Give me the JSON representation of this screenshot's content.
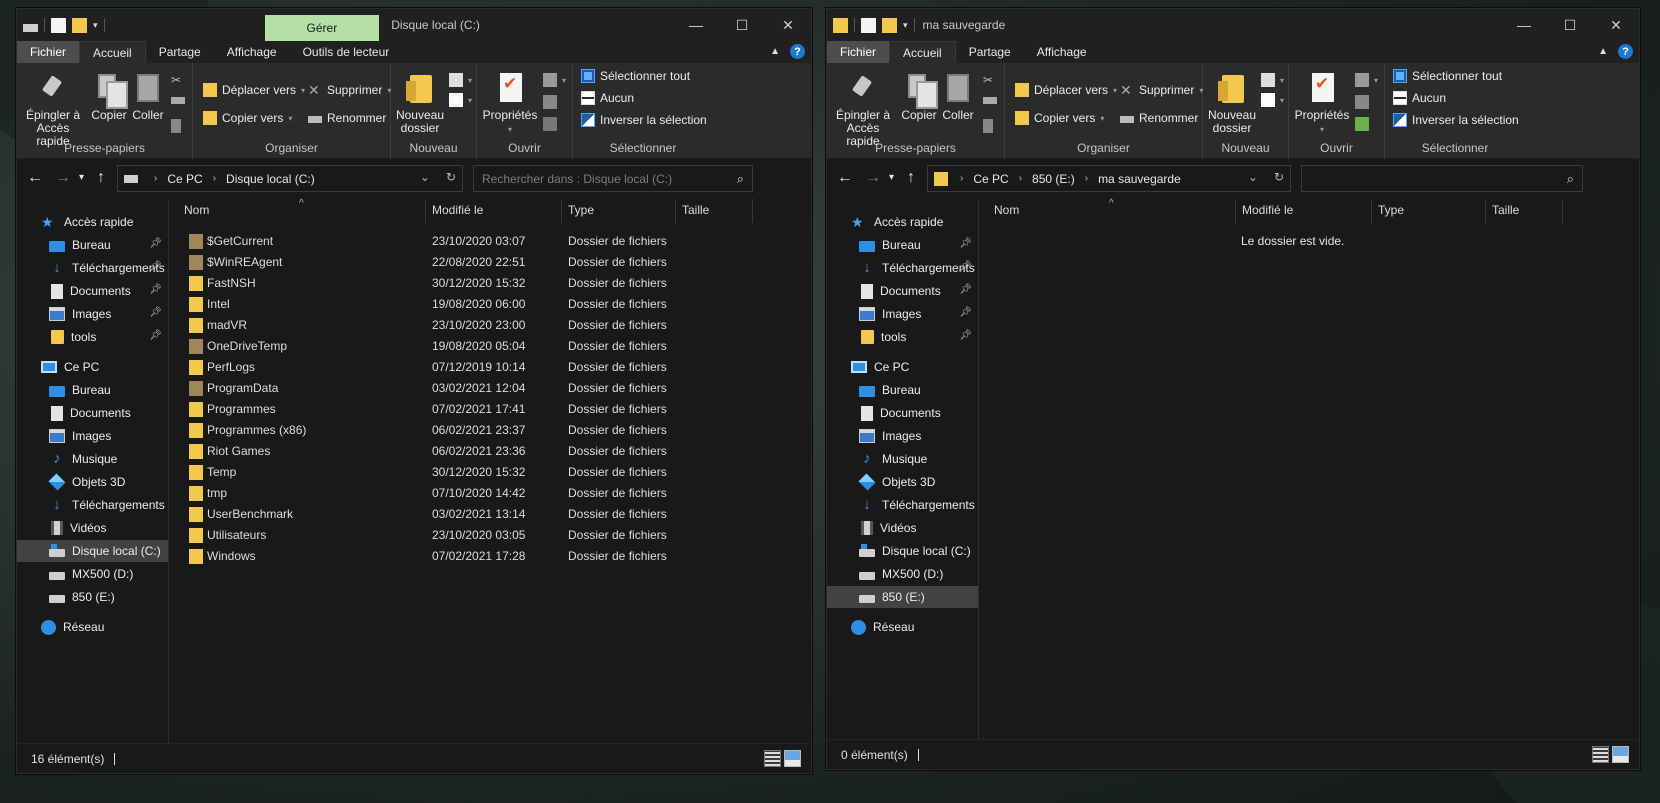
{
  "left": {
    "title": "Disque local (C:)",
    "manage_tab": "Gérer",
    "tabs": [
      "Fichier",
      "Accueil",
      "Partage",
      "Affichage",
      "Outils de lecteur"
    ],
    "ribbon": {
      "pin": "Épingler à Accès rapide",
      "copy": "Copier",
      "paste": "Coller",
      "clipboard_group": "Presse-papiers",
      "move_to": "Déplacer vers",
      "copy_to": "Copier vers",
      "delete": "Supprimer",
      "rename": "Renommer",
      "organize_group": "Organiser",
      "new_folder": "Nouveau dossier",
      "new_group": "Nouveau",
      "properties": "Propriétés",
      "open_group": "Ouvrir",
      "select_all": "Sélectionner tout",
      "select_none": "Aucun",
      "invert_selection": "Inverser la sélection",
      "select_group": "Sélectionner"
    },
    "breadcrumb": [
      "Ce PC",
      "Disque local (C:)"
    ],
    "search_placeholder": "Rechercher dans : Disque local (C:)",
    "nav": {
      "quick_access": "Accès rapide",
      "quick": [
        "Bureau",
        "Téléchargements",
        "Documents",
        "Images",
        "tools"
      ],
      "this_pc": "Ce PC",
      "pc": [
        "Bureau",
        "Documents",
        "Images",
        "Musique",
        "Objets 3D",
        "Téléchargements",
        "Vidéos",
        "Disque local (C:)",
        "MX500 (D:)",
        "850 (E:)"
      ],
      "network": "Réseau"
    },
    "columns": [
      "Nom",
      "Modifié le",
      "Type",
      "Taille"
    ],
    "files": [
      {
        "name": "$GetCurrent",
        "date": "23/10/2020 03:07",
        "type": "Dossier de fichiers",
        "hidden": true
      },
      {
        "name": "$WinREAgent",
        "date": "22/08/2020 22:51",
        "type": "Dossier de fichiers",
        "hidden": true
      },
      {
        "name": "FastNSH",
        "date": "30/12/2020 15:32",
        "type": "Dossier de fichiers",
        "hidden": false
      },
      {
        "name": "Intel",
        "date": "19/08/2020 06:00",
        "type": "Dossier de fichiers",
        "hidden": false
      },
      {
        "name": "madVR",
        "date": "23/10/2020 23:00",
        "type": "Dossier de fichiers",
        "hidden": false
      },
      {
        "name": "OneDriveTemp",
        "date": "19/08/2020 05:04",
        "type": "Dossier de fichiers",
        "hidden": true
      },
      {
        "name": "PerfLogs",
        "date": "07/12/2019 10:14",
        "type": "Dossier de fichiers",
        "hidden": false
      },
      {
        "name": "ProgramData",
        "date": "03/02/2021 12:04",
        "type": "Dossier de fichiers",
        "hidden": true
      },
      {
        "name": "Programmes",
        "date": "07/02/2021 17:41",
        "type": "Dossier de fichiers",
        "hidden": false
      },
      {
        "name": "Programmes (x86)",
        "date": "06/02/2021 23:37",
        "type": "Dossier de fichiers",
        "hidden": false
      },
      {
        "name": "Riot Games",
        "date": "06/02/2021 23:36",
        "type": "Dossier de fichiers",
        "hidden": false
      },
      {
        "name": "Temp",
        "date": "30/12/2020 15:32",
        "type": "Dossier de fichiers",
        "hidden": false
      },
      {
        "name": "tmp",
        "date": "07/10/2020 14:42",
        "type": "Dossier de fichiers",
        "hidden": false
      },
      {
        "name": "UserBenchmark",
        "date": "03/02/2021 13:14",
        "type": "Dossier de fichiers",
        "hidden": false
      },
      {
        "name": "Utilisateurs",
        "date": "23/10/2020 03:05",
        "type": "Dossier de fichiers",
        "hidden": false
      },
      {
        "name": "Windows",
        "date": "07/02/2021 17:28",
        "type": "Dossier de fichiers",
        "hidden": false
      }
    ],
    "status": "16 élément(s)"
  },
  "right": {
    "title": "ma sauvegarde",
    "tabs": [
      "Fichier",
      "Accueil",
      "Partage",
      "Affichage"
    ],
    "breadcrumb": [
      "Ce PC",
      "850 (E:)",
      "ma sauvegarde"
    ],
    "search_placeholder": "",
    "columns": [
      "Nom",
      "Modifié le",
      "Type",
      "Taille"
    ],
    "empty_message": "Le dossier est vide.",
    "status": "0 élément(s)"
  },
  "colors": {
    "accent_blue": "#2f8ee5",
    "folder_yellow": "#f2c94c",
    "manage_tab_green": "#b4e0a6",
    "help_blue": "#1d78d2"
  }
}
